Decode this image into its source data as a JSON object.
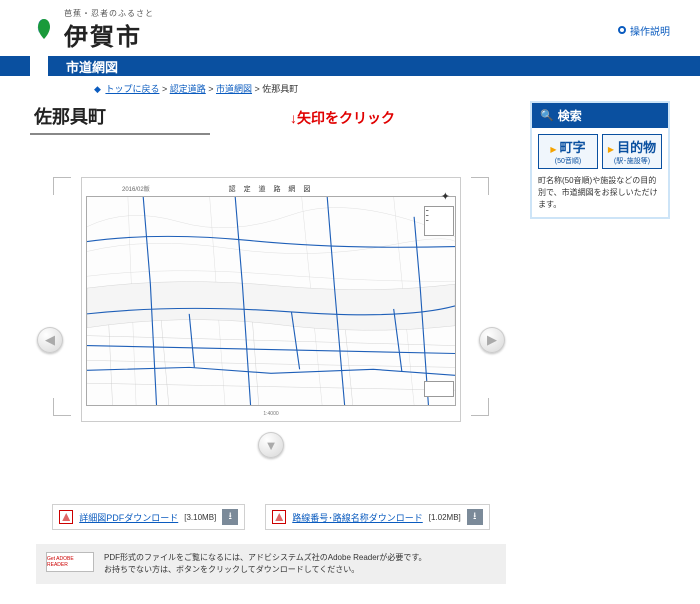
{
  "header": {
    "tagline": "芭蕉・忍者のふるさと",
    "site_name": "伊賀市",
    "guide_label": "操作説明"
  },
  "tabs": {
    "active": "市道網図"
  },
  "breadcrumb": {
    "items": [
      "トップに戻る",
      "認定道路",
      "市道網図"
    ],
    "current": "佐那具町"
  },
  "main": {
    "title": "佐那具町",
    "hint": "↓矢印をクリック",
    "map": {
      "header": "認 定 道 路 網 図",
      "date_label": "2016/02版",
      "footer": "1:4000"
    }
  },
  "downloads": [
    {
      "label": "詳細図PDFダウンロード",
      "size": "[3.10MB]"
    },
    {
      "label": "路線番号･路線名称ダウンロード",
      "size": "[1.02MB]"
    }
  ],
  "reader_note": {
    "badge": "Get ADOBE READER",
    "line1": "PDF形式のファイルをご覧になるには、アドビシステムズ社のAdobe Readerが必要です。",
    "line2": "お持ちでない方は、ボタンをクリックしてダウンロードしてください。"
  },
  "sidebar": {
    "search_title": "検索",
    "tabs": [
      {
        "main": "町字",
        "sub": "(50音順)"
      },
      {
        "main": "目的物",
        "sub": "(駅･施設等)"
      }
    ],
    "desc": "町名称(50音順)や施設などの目的別で、市道網図をお探しいただけます。"
  }
}
